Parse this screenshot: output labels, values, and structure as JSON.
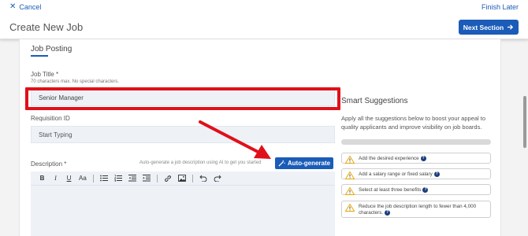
{
  "topbar": {
    "cancel_label": "Cancel",
    "finish_label": "Finish Later"
  },
  "header": {
    "title": "Create New Job",
    "next_label": "Next Section"
  },
  "form": {
    "section_title": "Job Posting",
    "job_title_label": "Job Title *",
    "job_title_hint": "70 characters max. No special characters.",
    "job_title_value": "Senior Manager",
    "requisition_label": "Requisition ID",
    "requisition_placeholder": "Start Typing",
    "description_label": "Description *",
    "autogen_hint": "Auto-generate a job description using AI to get you started",
    "autogen_label": "Auto-generate"
  },
  "toolbar": {
    "bold": "B",
    "italic": "I",
    "underline": "U",
    "font_size": "Aa"
  },
  "smart": {
    "title": "Smart Suggestions",
    "description": "Apply all the suggestions below to boost your appeal to quality applicants and improve visibility on job boards.",
    "suggestions": [
      "Add the desired experience",
      "Add a salary range or fixed salary",
      "Select at least three benefits",
      "Reduce the job description length to fewer than 4,000 characters."
    ]
  },
  "colors": {
    "accent": "#1a5cb8",
    "highlight": "#e0101a",
    "warning": "#e6a700"
  }
}
